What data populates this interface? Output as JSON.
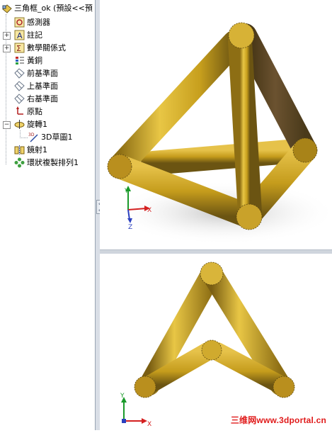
{
  "feature_tree": {
    "root_label": "三角框_ok (預設<<預",
    "items": [
      {
        "label": "感測器",
        "icon": "sensor-icon"
      },
      {
        "label": "註記",
        "icon": "annotation-icon"
      },
      {
        "label": "數學關係式",
        "icon": "equation-icon"
      },
      {
        "label": "黃銅",
        "icon": "material-icon"
      },
      {
        "label": "前基準面",
        "icon": "plane-icon"
      },
      {
        "label": "上基準面",
        "icon": "plane-icon"
      },
      {
        "label": "右基準面",
        "icon": "plane-icon"
      },
      {
        "label": "原點",
        "icon": "origin-icon"
      },
      {
        "label": "旋轉1",
        "icon": "revolve-icon"
      },
      {
        "label": "3D草圖1",
        "icon": "sketch3d-icon"
      },
      {
        "label": "鏡射1",
        "icon": "mirror-icon"
      },
      {
        "label": "環狀複製排列1",
        "icon": "circular-pattern-icon"
      }
    ]
  },
  "viewport_top": {
    "triad": {
      "x_label": "X",
      "y_label": "Y",
      "z_label": "Z"
    }
  },
  "viewport_bottom": {
    "triad": {
      "x_label": "X",
      "y_label": "Y"
    }
  },
  "watermark": "三维网www.3dportal.cn",
  "colors": {
    "tube_light": "#e8c645",
    "tube_mid": "#c79f1d",
    "tube_dark": "#6b5412",
    "axis_x": "#d42020",
    "axis_y": "#1a9a2a",
    "axis_z": "#2a3fbf"
  }
}
